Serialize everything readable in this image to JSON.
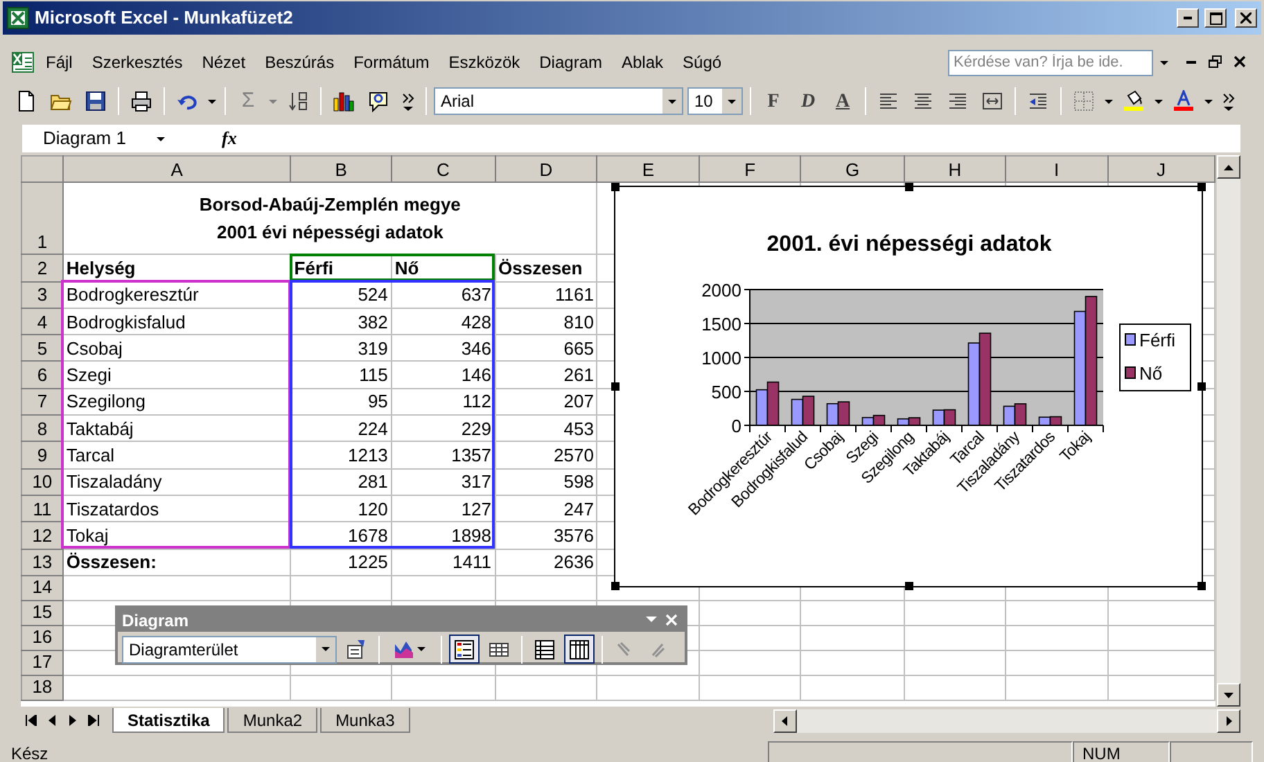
{
  "window": {
    "title": "Microsoft Excel - Munkafüzet2"
  },
  "menu": [
    "Fájl",
    "Szerkesztés",
    "Nézet",
    "Beszúrás",
    "Formátum",
    "Eszközök",
    "Diagram",
    "Ablak",
    "Súgó"
  ],
  "ask_box": {
    "placeholder": "Kérdése van? Írja be ide."
  },
  "toolbar": {
    "sum": "Σ",
    "font": "Arial",
    "size": "10",
    "format_buttons": [
      "F",
      "D",
      "A"
    ]
  },
  "formula_bar": {
    "name_box": "Diagram 1",
    "fx": "fx"
  },
  "columns": [
    "A",
    "B",
    "C",
    "D",
    "E",
    "F",
    "G",
    "H",
    "I",
    "J"
  ],
  "rows": [
    {
      "number": "1",
      "kind": "title",
      "text": "Borsod-Abaúj-Zemplén megye\n2001 évi népességi adatok"
    },
    {
      "number": "2",
      "kind": "header",
      "cells": [
        "Helység",
        {
          "text": "Férfi",
          "color": "#008000"
        },
        {
          "text": "Nő",
          "color": "#008000"
        },
        "Összesen"
      ]
    },
    {
      "number": "3",
      "kind": "data",
      "cells": [
        {
          "text": "Bodrogkeresztúr",
          "color": "#cc33cc"
        },
        {
          "text": "524",
          "color": "#3333ff"
        },
        "637",
        "1161"
      ]
    },
    {
      "number": "4",
      "kind": "data",
      "cells": [
        "Bodrogkisfalud",
        "382",
        "428",
        "810"
      ]
    },
    {
      "number": "5",
      "kind": "data",
      "cells": [
        "Csobaj",
        "319",
        "346",
        "665"
      ]
    },
    {
      "number": "6",
      "kind": "data",
      "cells": [
        "Szegi",
        "115",
        "146",
        "261"
      ]
    },
    {
      "number": "7",
      "kind": "data",
      "cells": [
        "Szegilong",
        "95",
        "112",
        "207"
      ]
    },
    {
      "number": "8",
      "kind": "data",
      "cells": [
        "Taktabáj",
        "224",
        "229",
        "453"
      ]
    },
    {
      "number": "9",
      "kind": "data",
      "cells": [
        "Tarcal",
        "1213",
        "1357",
        "2570"
      ]
    },
    {
      "number": "10",
      "kind": "data",
      "cells": [
        "Tiszaladány",
        "281",
        "317",
        "598"
      ]
    },
    {
      "number": "11",
      "kind": "data",
      "cells": [
        "Tiszatardos",
        "120",
        "127",
        "247"
      ]
    },
    {
      "number": "12",
      "kind": "data",
      "cells": [
        {
          "text": "Tokaj",
          "color": "#cc33cc"
        },
        "1678",
        {
          "text": "1898",
          "color": "#3333ff"
        },
        "3576"
      ]
    },
    {
      "number": "13",
      "kind": "total",
      "cells": [
        "Összesen:",
        "1225",
        "1411",
        "2636"
      ]
    },
    {
      "number": "14",
      "kind": "empty"
    },
    {
      "number": "15",
      "kind": "empty"
    },
    {
      "number": "16",
      "kind": "empty"
    },
    {
      "number": "17",
      "kind": "empty"
    },
    {
      "number": "18",
      "kind": "empty"
    }
  ],
  "chart": {
    "chart_data": {
      "type": "bar",
      "title": "2001. évi népességi adatok",
      "categories": [
        "Bodrogkeresztúr",
        "Bodrogkisfalud",
        "Csobaj",
        "Szegi",
        "Szegilong",
        "Taktabáj",
        "Tarcal",
        "Tiszaladány",
        "Tiszatardos",
        "Tokaj"
      ],
      "series": [
        {
          "name": "Férfi",
          "color": "#9999ff",
          "values": [
            524,
            382,
            319,
            115,
            95,
            224,
            1213,
            281,
            120,
            1678
          ]
        },
        {
          "name": "Nő",
          "color": "#993366",
          "values": [
            637,
            428,
            346,
            146,
            112,
            229,
            1357,
            317,
            127,
            1898
          ]
        }
      ],
      "ylim": [
        0,
        2000
      ],
      "yticks": [
        0,
        500,
        1000,
        1500,
        2000
      ],
      "grid": true,
      "legend": true
    }
  },
  "diagram_toolbar": {
    "title": "Diagram",
    "object_select": "Diagramterület",
    "buttons": [
      {
        "kind": "format",
        "on": false
      },
      {
        "kind": "chart_type",
        "on": false
      },
      {
        "kind": "legend",
        "on": true
      },
      {
        "kind": "data_table",
        "on": false
      },
      {
        "kind": "by_row",
        "on": false
      },
      {
        "kind": "by_column",
        "on": true
      },
      {
        "kind": "angle_down",
        "on": false
      },
      {
        "kind": "angle_up",
        "on": false
      }
    ]
  },
  "sheet_tabs": [
    {
      "label": "Statisztika",
      "selected": true
    },
    {
      "label": "Munka2",
      "selected": false
    },
    {
      "label": "Munka3",
      "selected": false
    }
  ],
  "status_bar": {
    "text": "Kész",
    "num": "NUM"
  }
}
